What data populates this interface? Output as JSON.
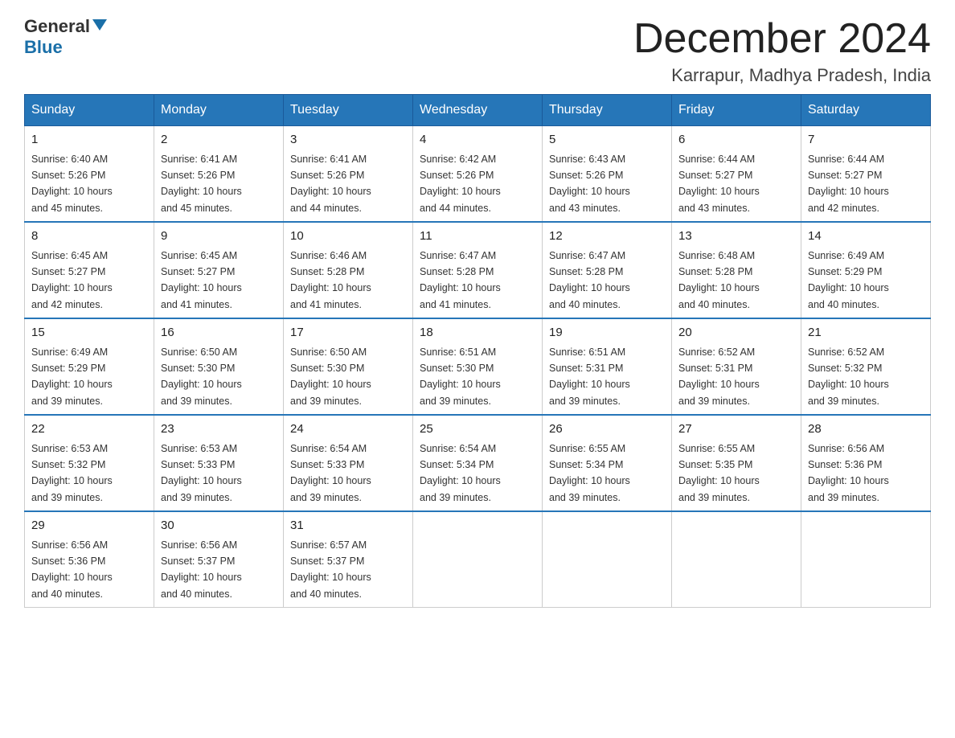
{
  "header": {
    "logo_general": "General",
    "logo_blue": "Blue",
    "month_title": "December 2024",
    "location": "Karrapur, Madhya Pradesh, India"
  },
  "days_of_week": [
    "Sunday",
    "Monday",
    "Tuesday",
    "Wednesday",
    "Thursday",
    "Friday",
    "Saturday"
  ],
  "weeks": [
    [
      {
        "day": "1",
        "sunrise": "6:40 AM",
        "sunset": "5:26 PM",
        "daylight": "10 hours and 45 minutes."
      },
      {
        "day": "2",
        "sunrise": "6:41 AM",
        "sunset": "5:26 PM",
        "daylight": "10 hours and 45 minutes."
      },
      {
        "day": "3",
        "sunrise": "6:41 AM",
        "sunset": "5:26 PM",
        "daylight": "10 hours and 44 minutes."
      },
      {
        "day": "4",
        "sunrise": "6:42 AM",
        "sunset": "5:26 PM",
        "daylight": "10 hours and 44 minutes."
      },
      {
        "day": "5",
        "sunrise": "6:43 AM",
        "sunset": "5:26 PM",
        "daylight": "10 hours and 43 minutes."
      },
      {
        "day": "6",
        "sunrise": "6:44 AM",
        "sunset": "5:27 PM",
        "daylight": "10 hours and 43 minutes."
      },
      {
        "day": "7",
        "sunrise": "6:44 AM",
        "sunset": "5:27 PM",
        "daylight": "10 hours and 42 minutes."
      }
    ],
    [
      {
        "day": "8",
        "sunrise": "6:45 AM",
        "sunset": "5:27 PM",
        "daylight": "10 hours and 42 minutes."
      },
      {
        "day": "9",
        "sunrise": "6:45 AM",
        "sunset": "5:27 PM",
        "daylight": "10 hours and 41 minutes."
      },
      {
        "day": "10",
        "sunrise": "6:46 AM",
        "sunset": "5:28 PM",
        "daylight": "10 hours and 41 minutes."
      },
      {
        "day": "11",
        "sunrise": "6:47 AM",
        "sunset": "5:28 PM",
        "daylight": "10 hours and 41 minutes."
      },
      {
        "day": "12",
        "sunrise": "6:47 AM",
        "sunset": "5:28 PM",
        "daylight": "10 hours and 40 minutes."
      },
      {
        "day": "13",
        "sunrise": "6:48 AM",
        "sunset": "5:28 PM",
        "daylight": "10 hours and 40 minutes."
      },
      {
        "day": "14",
        "sunrise": "6:49 AM",
        "sunset": "5:29 PM",
        "daylight": "10 hours and 40 minutes."
      }
    ],
    [
      {
        "day": "15",
        "sunrise": "6:49 AM",
        "sunset": "5:29 PM",
        "daylight": "10 hours and 39 minutes."
      },
      {
        "day": "16",
        "sunrise": "6:50 AM",
        "sunset": "5:30 PM",
        "daylight": "10 hours and 39 minutes."
      },
      {
        "day": "17",
        "sunrise": "6:50 AM",
        "sunset": "5:30 PM",
        "daylight": "10 hours and 39 minutes."
      },
      {
        "day": "18",
        "sunrise": "6:51 AM",
        "sunset": "5:30 PM",
        "daylight": "10 hours and 39 minutes."
      },
      {
        "day": "19",
        "sunrise": "6:51 AM",
        "sunset": "5:31 PM",
        "daylight": "10 hours and 39 minutes."
      },
      {
        "day": "20",
        "sunrise": "6:52 AM",
        "sunset": "5:31 PM",
        "daylight": "10 hours and 39 minutes."
      },
      {
        "day": "21",
        "sunrise": "6:52 AM",
        "sunset": "5:32 PM",
        "daylight": "10 hours and 39 minutes."
      }
    ],
    [
      {
        "day": "22",
        "sunrise": "6:53 AM",
        "sunset": "5:32 PM",
        "daylight": "10 hours and 39 minutes."
      },
      {
        "day": "23",
        "sunrise": "6:53 AM",
        "sunset": "5:33 PM",
        "daylight": "10 hours and 39 minutes."
      },
      {
        "day": "24",
        "sunrise": "6:54 AM",
        "sunset": "5:33 PM",
        "daylight": "10 hours and 39 minutes."
      },
      {
        "day": "25",
        "sunrise": "6:54 AM",
        "sunset": "5:34 PM",
        "daylight": "10 hours and 39 minutes."
      },
      {
        "day": "26",
        "sunrise": "6:55 AM",
        "sunset": "5:34 PM",
        "daylight": "10 hours and 39 minutes."
      },
      {
        "day": "27",
        "sunrise": "6:55 AM",
        "sunset": "5:35 PM",
        "daylight": "10 hours and 39 minutes."
      },
      {
        "day": "28",
        "sunrise": "6:56 AM",
        "sunset": "5:36 PM",
        "daylight": "10 hours and 39 minutes."
      }
    ],
    [
      {
        "day": "29",
        "sunrise": "6:56 AM",
        "sunset": "5:36 PM",
        "daylight": "10 hours and 40 minutes."
      },
      {
        "day": "30",
        "sunrise": "6:56 AM",
        "sunset": "5:37 PM",
        "daylight": "10 hours and 40 minutes."
      },
      {
        "day": "31",
        "sunrise": "6:57 AM",
        "sunset": "5:37 PM",
        "daylight": "10 hours and 40 minutes."
      },
      null,
      null,
      null,
      null
    ]
  ],
  "labels": {
    "sunrise": "Sunrise:",
    "sunset": "Sunset:",
    "daylight": "Daylight:"
  }
}
